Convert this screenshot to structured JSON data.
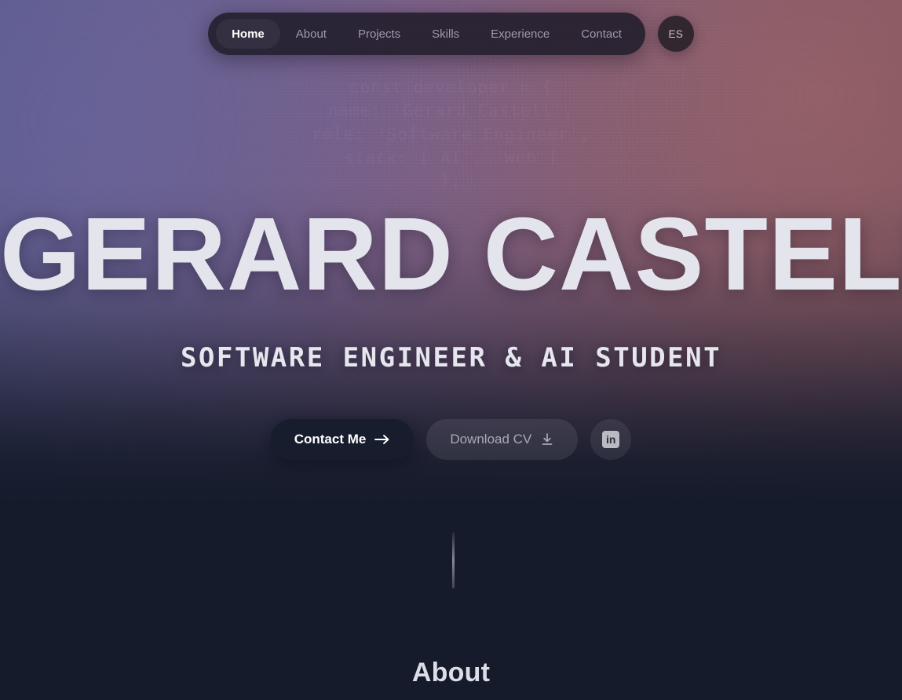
{
  "theme": {
    "gradient_left": "#5f5d90",
    "gradient_right": "#7e5460",
    "page_dark": "#151b2b",
    "accent_text": "#e4e4ec",
    "nav_muted": "#9d99ab",
    "primary_button_bg": "#171d2d"
  },
  "navbar": {
    "items": [
      {
        "label": "Home",
        "active": true
      },
      {
        "label": "About",
        "active": false
      },
      {
        "label": "Projects",
        "active": false
      },
      {
        "label": "Skills",
        "active": false
      },
      {
        "label": "Experience",
        "active": false
      },
      {
        "label": "Contact",
        "active": false
      }
    ],
    "language_button": {
      "label": "ES",
      "icon": "globe-language-icon"
    }
  },
  "hero": {
    "title": "GERARD CASTELL",
    "subtitle": "SOFTWARE ENGINEER & AI STUDENT",
    "ghost_text": "const developer = {\nname: 'Gerard Castell',\nrole: 'Software Engineer',\nstack: ['AI', 'Web']\n};",
    "actions": {
      "primary": {
        "label": "Contact Me",
        "icon": "arrow-right-icon"
      },
      "secondary": {
        "label": "Download CV",
        "icon": "download-icon"
      },
      "social": {
        "label": "in",
        "icon": "linkedin-icon",
        "name": "LinkedIn"
      }
    }
  },
  "scroll_indicator": {
    "icon": "scroll-down-indicator"
  },
  "about": {
    "heading": "About"
  }
}
